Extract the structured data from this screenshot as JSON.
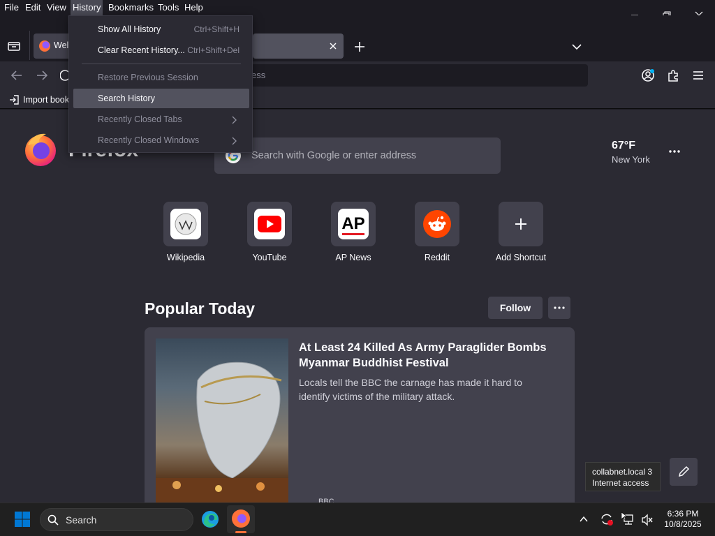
{
  "menubar": {
    "items": [
      "File",
      "Edit",
      "View",
      "History",
      "Bookmarks",
      "Tools",
      "Help"
    ],
    "active": "History"
  },
  "tabs": {
    "active_tab_label": "Welc"
  },
  "urlbar": {
    "placeholder_fragment": "ess"
  },
  "bookmarks_bar": {
    "import_label": "Import book"
  },
  "history_menu": {
    "items": [
      {
        "label": "Show All History",
        "shortcut": "Ctrl+Shift+H",
        "state": "enabled"
      },
      {
        "label": "Clear Recent History...",
        "shortcut": "Ctrl+Shift+Del",
        "state": "enabled"
      },
      {
        "label": "Restore Previous Session",
        "shortcut": "",
        "state": "disabled"
      },
      {
        "label": "Search History",
        "shortcut": "",
        "state": "hover"
      },
      {
        "label": "Recently Closed Tabs",
        "shortcut": "",
        "state": "disabled",
        "submenu": true
      },
      {
        "label": "Recently Closed Windows",
        "shortcut": "",
        "state": "disabled",
        "submenu": true
      }
    ]
  },
  "newtab": {
    "logo_text": "Firefox",
    "search_placeholder": "Search with Google or enter address",
    "weather": {
      "temp": "67°F",
      "city": "New York"
    },
    "shortcuts": [
      {
        "label": "Wikipedia",
        "icon": "wikipedia-icon"
      },
      {
        "label": "YouTube",
        "icon": "youtube-icon"
      },
      {
        "label": "AP News",
        "icon": "ap-news-icon"
      },
      {
        "label": "Reddit",
        "icon": "reddit-icon"
      },
      {
        "label": "Add Shortcut",
        "icon": "plus-icon"
      }
    ],
    "popular_heading": "Popular Today",
    "follow_label": "Follow",
    "story": {
      "headline": "At Least 24 Killed As Army Paraglider Bombs Myanmar Buddhist Festival",
      "excerpt": "Locals tell the BBC the carnage has made it hard to identify victims of the military attack.",
      "source": "BBC"
    }
  },
  "tooltip": {
    "line1": "collabnet.local 3",
    "line2": "Internet access"
  },
  "taskbar": {
    "search_label": "Search",
    "time": "6:36 PM",
    "date": "10/8/2025"
  },
  "colors": {
    "accent_blue": "#0078d4",
    "firefox_orange": "#ff7139",
    "reddit_orange": "#ff4500",
    "youtube_red": "#ff0000",
    "hover_gray": "#52525e"
  }
}
